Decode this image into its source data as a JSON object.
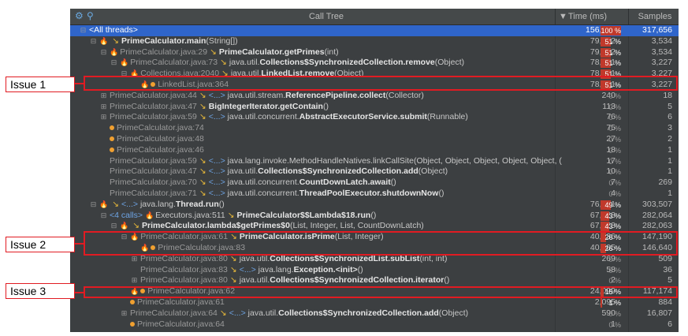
{
  "header": {
    "title": "Call Tree",
    "time_label": "Time (ms)",
    "samples_label": "Samples",
    "sort_indicator": "▼"
  },
  "issues": [
    "Issue 1",
    "Issue 2",
    "Issue 3"
  ],
  "colors": {
    "selected": "#2f65ca",
    "hot": "#c0392b",
    "issue_border": "#e11b22",
    "background": "#3c3f41"
  },
  "rows": [
    {
      "indent": 0,
      "toggle": "⊟",
      "pre": "",
      "frame": "<All threads>",
      "arrow": false,
      "calls": "",
      "method": "",
      "time": "156,031",
      "pct": "100 %",
      "pctval": 100,
      "samples": "317,656",
      "selected": true
    },
    {
      "indent": 1,
      "toggle": "⊟",
      "pre": "flame",
      "frame": "",
      "arrow": true,
      "calls": "",
      "bold": "PrimeCalculator.main",
      "rest": "(String[])",
      "time": "79,522",
      "pct": "51 %",
      "pctval": 51,
      "samples": "3,534"
    },
    {
      "indent": 2,
      "toggle": "⊟",
      "pre": "flame",
      "frame": "PrimeCalculator.java:29",
      "arrow": true,
      "calls": "",
      "bold": "PrimeCalculator.getPrimes",
      "rest": "(int)",
      "time": "79,522",
      "pct": "51 %",
      "pctval": 51,
      "samples": "3,534"
    },
    {
      "indent": 3,
      "toggle": "⊟",
      "pre": "flame",
      "frame": "PrimeCalculator.java:73",
      "arrow": true,
      "calls": "",
      "plain": "java.util.",
      "bold": "Collections$SynchronizedCollection.remove",
      "rest": "(Object)",
      "time": "78,931",
      "pct": "51 %",
      "pctval": 51,
      "samples": "3,227"
    },
    {
      "indent": 4,
      "toggle": "⊟",
      "pre": "flame",
      "frame": "Collections.java:2040",
      "arrow": true,
      "calls": "",
      "plain": "java.util.",
      "bold": "LinkedList.remove",
      "rest": "(Object)",
      "time": "78,931",
      "pct": "51 %",
      "pctval": 51,
      "samples": "3,227"
    },
    {
      "indent": 5,
      "toggle": "",
      "pre": "flamedot",
      "frame": "LinkedList.java:364",
      "arrow": false,
      "calls": "",
      "time": "78,931",
      "pct": "51 %",
      "pctval": 51,
      "samples": "3,227"
    },
    {
      "indent": 2,
      "toggle": "⊞",
      "pre": "",
      "frame": "PrimeCalculator.java:44",
      "arrow": true,
      "calls": "<...>",
      "plain": "java.util.stream.",
      "bold": "ReferencePipeline.collect",
      "rest": "(Collector)",
      "time": "240",
      "pct": "0 %",
      "pctval": 0,
      "samples": "18"
    },
    {
      "indent": 2,
      "toggle": "⊞",
      "pre": "",
      "frame": "PrimeCalculator.java:47",
      "arrow": true,
      "calls": "",
      "bold": "BigIntegerIterator.getContain",
      "rest": "()",
      "time": "113",
      "pct": "0 %",
      "pctval": 0,
      "samples": "5"
    },
    {
      "indent": 2,
      "toggle": "⊞",
      "pre": "",
      "frame": "PrimeCalculator.java:59",
      "arrow": true,
      "calls": "<...>",
      "plain": "java.util.concurrent.",
      "bold": "AbstractExecutorService.submit",
      "rest": "(Runnable)",
      "time": "76",
      "pct": "0 %",
      "pctval": 0,
      "samples": "6"
    },
    {
      "indent": 2,
      "toggle": "",
      "pre": "dot",
      "frame": "PrimeCalculator.java:74",
      "arrow": false,
      "calls": "",
      "time": "75",
      "pct": "0 %",
      "pctval": 0,
      "samples": "3"
    },
    {
      "indent": 2,
      "toggle": "",
      "pre": "dot",
      "frame": "PrimeCalculator.java:48",
      "arrow": false,
      "calls": "",
      "time": "27",
      "pct": "0 %",
      "pctval": 0,
      "samples": "2"
    },
    {
      "indent": 2,
      "toggle": "",
      "pre": "dot",
      "frame": "PrimeCalculator.java:46",
      "arrow": false,
      "calls": "",
      "time": "18",
      "pct": "0 %",
      "pctval": 0,
      "samples": "1"
    },
    {
      "indent": 2,
      "toggle": "",
      "pre": "",
      "frame": "PrimeCalculator.java:59",
      "arrow": true,
      "calls": "<...>",
      "plain": "java.lang.invoke.MethodHandleNatives.linkCallSite(Object, Object, Object, Object, Object, (",
      "time": "17",
      "pct": "0 %",
      "pctval": 0,
      "samples": "1"
    },
    {
      "indent": 2,
      "toggle": "",
      "pre": "",
      "frame": "PrimeCalculator.java:47",
      "arrow": true,
      "calls": "<...>",
      "plain": "java.util.",
      "bold": "Collections$SynchronizedCollection.add",
      "rest": "(Object)",
      "time": "10",
      "pct": "0 %",
      "pctval": 0,
      "samples": "1"
    },
    {
      "indent": 2,
      "toggle": "",
      "pre": "",
      "frame": "PrimeCalculator.java:70",
      "arrow": true,
      "calls": "<...>",
      "plain": "java.util.concurrent.",
      "bold": "CountDownLatch.await",
      "rest": "()",
      "time": "7",
      "pct": "0 %",
      "pctval": 0,
      "samples": "269"
    },
    {
      "indent": 2,
      "toggle": "",
      "pre": "",
      "frame": "PrimeCalculator.java:71",
      "arrow": true,
      "calls": "<...>",
      "plain": "java.util.concurrent.",
      "bold": "ThreadPoolExecutor.shutdownNow",
      "rest": "()",
      "time": "4",
      "pct": "0 %",
      "pctval": 0,
      "samples": "1"
    },
    {
      "indent": 1,
      "toggle": "⊟",
      "pre": "flame",
      "frame": "",
      "arrow": true,
      "calls": "<...>",
      "plain": "java.lang.",
      "bold": "Thread.run",
      "rest": "()",
      "time": "76,391",
      "pct": "49 %",
      "pctval": 49,
      "samples": "303,507"
    },
    {
      "indent": 2,
      "toggle": "⊟",
      "pre": "",
      "frame": "",
      "arrow": false,
      "calls": "<4 calls>",
      "pre2": "flame",
      "plain": "Executors.java:511",
      "arrow2": true,
      "bold": "PrimeCalculator$$Lambda$18.run",
      "rest": "()",
      "time": "67,723",
      "pct": "43 %",
      "pctval": 43,
      "samples": "282,064"
    },
    {
      "indent": 3,
      "toggle": "⊟",
      "pre": "flame",
      "frame": "",
      "arrow": true,
      "calls": "",
      "bold": "PrimeCalculator.lambda$getPrimes$0",
      "rest": "(List, Integer, List, CountDownLatch)",
      "time": "67,723",
      "pct": "43 %",
      "pctval": 43,
      "samples": "282,063"
    },
    {
      "indent": 4,
      "toggle": "⊟",
      "pre": "flame",
      "frame": "PrimeCalculator.java:61",
      "arrow": true,
      "calls": "",
      "bold": "PrimeCalculator.isPrime",
      "rest": "(List, Integer)",
      "time": "40,936",
      "pct": "26 %",
      "pctval": 26,
      "samples": "147,190"
    },
    {
      "indent": 5,
      "toggle": "",
      "pre": "flamedot",
      "frame": "PrimeCalculator.java:83",
      "arrow": false,
      "calls": "",
      "time": "40,605",
      "pct": "26 %",
      "pctval": 26,
      "samples": "146,640"
    },
    {
      "indent": 5,
      "toggle": "⊞",
      "pre": "",
      "frame": "PrimeCalculator.java:80",
      "arrow": true,
      "calls": "",
      "plain": "java.util.",
      "bold": "Collections$SynchronizedList.subList",
      "rest": "(int, int)",
      "time": "269",
      "pct": "0 %",
      "pctval": 0,
      "samples": "509"
    },
    {
      "indent": 5,
      "toggle": "",
      "pre": "",
      "frame": "PrimeCalculator.java:83",
      "arrow": true,
      "calls": "<...>",
      "plain": "java.lang.",
      "bold": "Exception.<init>",
      "rest": "()",
      "time": "58",
      "pct": "0 %",
      "pctval": 0,
      "samples": "36"
    },
    {
      "indent": 5,
      "toggle": "⊞",
      "pre": "",
      "frame": "PrimeCalculator.java:80",
      "arrow": true,
      "calls": "",
      "plain": "java.util.",
      "bold": "Collections$SynchronizedCollection.iterator",
      "rest": "()",
      "time": "2",
      "pct": "0 %",
      "pctval": 0,
      "samples": "5"
    },
    {
      "indent": 4,
      "toggle": "",
      "pre": "flamedot",
      "frame": "PrimeCalculator.java:62",
      "arrow": false,
      "calls": "",
      "time": "24,099",
      "pct": "15 %",
      "pctval": 15,
      "samples": "117,174"
    },
    {
      "indent": 4,
      "toggle": "",
      "pre": "dot",
      "frame": "PrimeCalculator.java:61",
      "arrow": false,
      "calls": "",
      "time": "2,095",
      "pct": "1 %",
      "pctval": 1,
      "samples": "884"
    },
    {
      "indent": 4,
      "toggle": "⊞",
      "pre": "",
      "frame": "PrimeCalculator.java:64",
      "arrow": true,
      "calls": "<...>",
      "plain": "java.util.",
      "bold": "Collections$SynchronizedCollection.add",
      "rest": "(Object)",
      "time": "590",
      "pct": "0 %",
      "pctval": 0,
      "samples": "16,807"
    },
    {
      "indent": 4,
      "toggle": "",
      "pre": "dot",
      "frame": "PrimeCalculator.java:64",
      "arrow": false,
      "calls": "",
      "time": "1",
      "pct": "0 %",
      "pctval": 0,
      "samples": "6"
    }
  ]
}
